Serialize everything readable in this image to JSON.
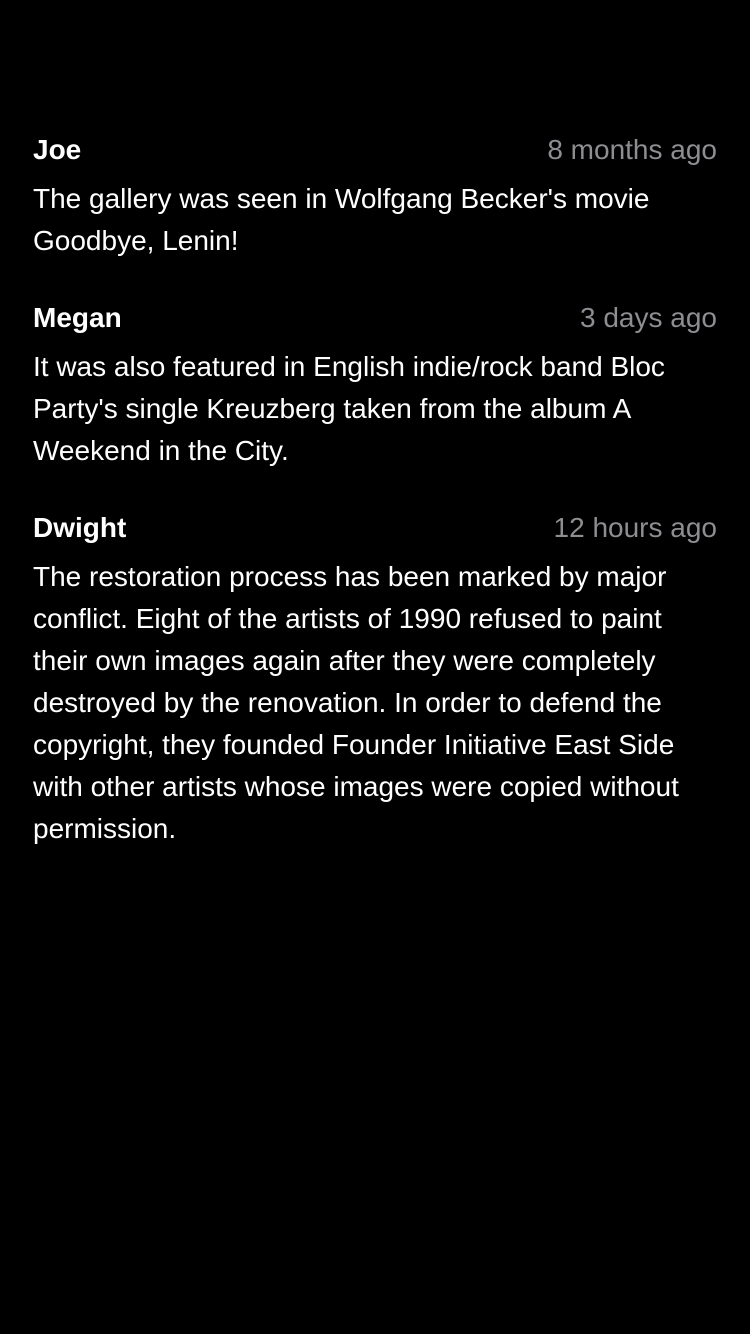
{
  "colors": {
    "background": "#000000",
    "text": "#ffffff",
    "secondary_text": "#8d8d92"
  },
  "comments": [
    {
      "author": "Joe",
      "time": "8 months ago",
      "text": "The gallery was seen in Wolfgang Becker's movie Goodbye, Lenin!"
    },
    {
      "author": "Megan",
      "time": "3 days ago",
      "text": "It was also featured in English indie/rock band Bloc Party's single Kreuzberg taken from the album A Weekend in the City."
    },
    {
      "author": "Dwight",
      "time": "12 hours ago",
      "text": "The restoration process has been marked by major conflict. Eight of the artists of 1990 refused to paint their own images again after they were completely destroyed by the renovation. In order to defend the copyright, they founded Founder Initiative East Side with other artists whose images were copied without permission."
    }
  ]
}
